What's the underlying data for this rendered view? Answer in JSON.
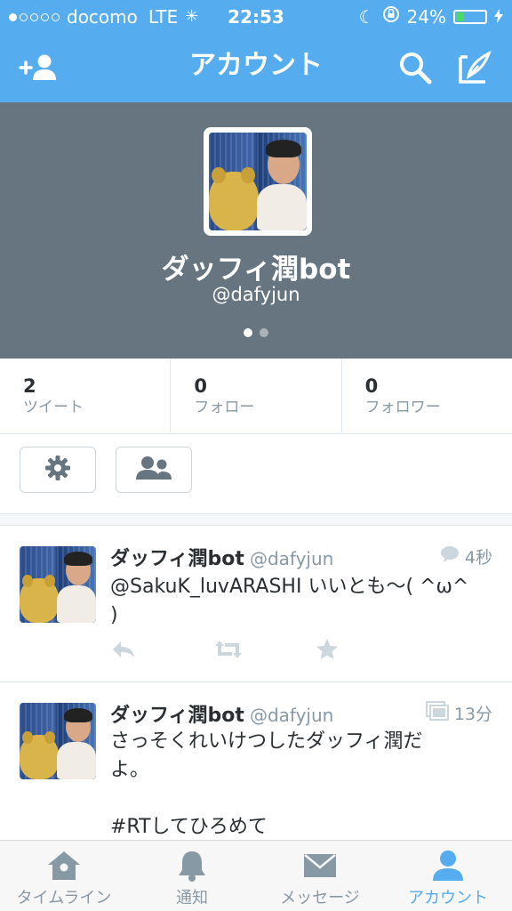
{
  "status_bar": {
    "carrier": "docomo",
    "network": "LTE",
    "time": "22:53",
    "battery": "24%",
    "battery_level": 0.24,
    "signal_bars": 1
  },
  "nav": {
    "title": "アカウント",
    "left_icon": "add-user-icon",
    "right_icons": [
      "search-icon",
      "compose-icon"
    ]
  },
  "profile": {
    "display_name": "ダッフィ潤bot",
    "handle": "@dafyjun",
    "page_count": 2,
    "active_page": 1
  },
  "stats": [
    {
      "count": "2",
      "label": "ツイート"
    },
    {
      "count": "0",
      "label": "フォロー"
    },
    {
      "count": "0",
      "label": "フォロワー"
    }
  ],
  "actions": [
    "settings-gear-icon",
    "people-icon"
  ],
  "tweets": [
    {
      "name": "ダッフィ潤bot",
      "handle": "@dafyjun",
      "time": "4秒",
      "time_icon": "reply-bubble-icon",
      "text": "@SakuK_luvARASHI いいとも〜( ^ω^\n)"
    },
    {
      "name": "ダッフィ潤bot",
      "handle": "@dafyjun",
      "time": "13分",
      "time_icon": "gallery-icon",
      "text": "さっそくれいけつしたダッフィ潤だ\nよ。\n\n#RTしてひろめて"
    }
  ],
  "tabbar": [
    {
      "label": "タイムライン",
      "icon": "home-icon",
      "active": false
    },
    {
      "label": "通知",
      "icon": "bell-icon",
      "active": false
    },
    {
      "label": "メッセージ",
      "icon": "envelope-icon",
      "active": false
    },
    {
      "label": "アカウント",
      "icon": "person-icon",
      "active": true
    }
  ],
  "colors": {
    "brand": "#55acee",
    "header_bg": "#66757f",
    "muted": "#8899a6",
    "battery": "#4cd964"
  }
}
